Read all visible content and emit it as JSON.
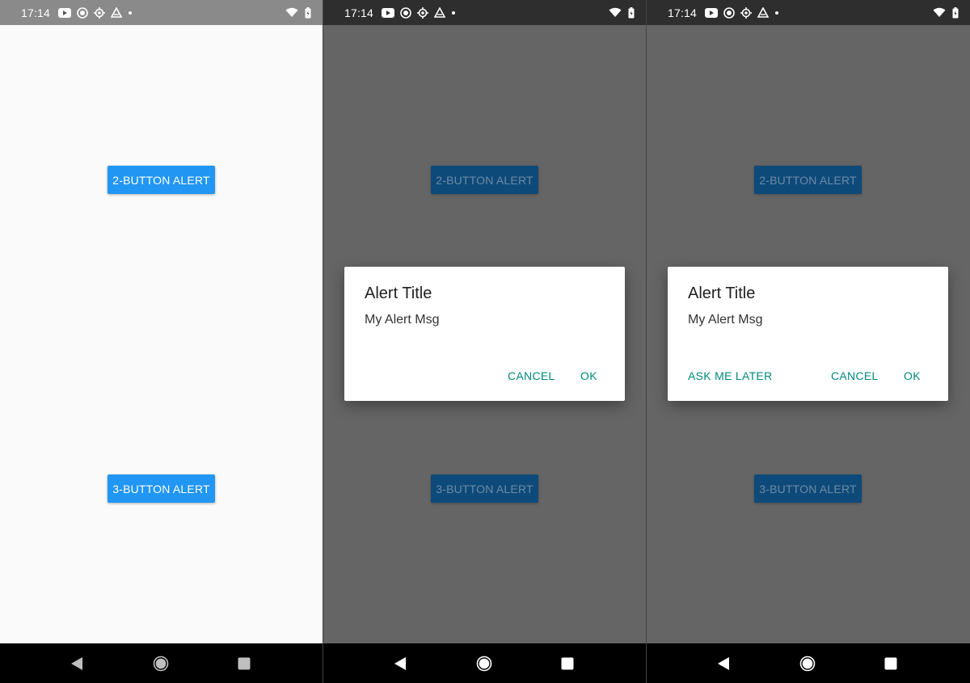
{
  "status": {
    "time": "17:14",
    "icons": [
      "youtube-icon",
      "record-icon",
      "settings-icon",
      "drive-icon",
      "dot-icon"
    ],
    "right_icons": [
      "wifi-icon",
      "battery-icon"
    ]
  },
  "screens": [
    {
      "buttons": {
        "two": "2-BUTTON ALERT",
        "three": "3-BUTTON ALERT"
      }
    },
    {
      "buttons": {
        "two": "2-BUTTON ALERT",
        "three": "3-BUTTON ALERT"
      },
      "dialog": {
        "title": "Alert Title",
        "message": "My Alert Msg",
        "cancel": "CANCEL",
        "ok": "OK"
      }
    },
    {
      "buttons": {
        "two": "2-BUTTON ALERT",
        "three": "3-BUTTON ALERT"
      },
      "dialog": {
        "title": "Alert Title",
        "message": "My Alert Msg",
        "neutral": "ASK ME LATER",
        "cancel": "CANCEL",
        "ok": "OK"
      }
    }
  ],
  "colors": {
    "primary_button": "#2196f3",
    "dialog_action": "#00897b",
    "scrim_background": "#656565"
  },
  "nav": [
    "back-icon",
    "home-icon",
    "recents-icon"
  ]
}
